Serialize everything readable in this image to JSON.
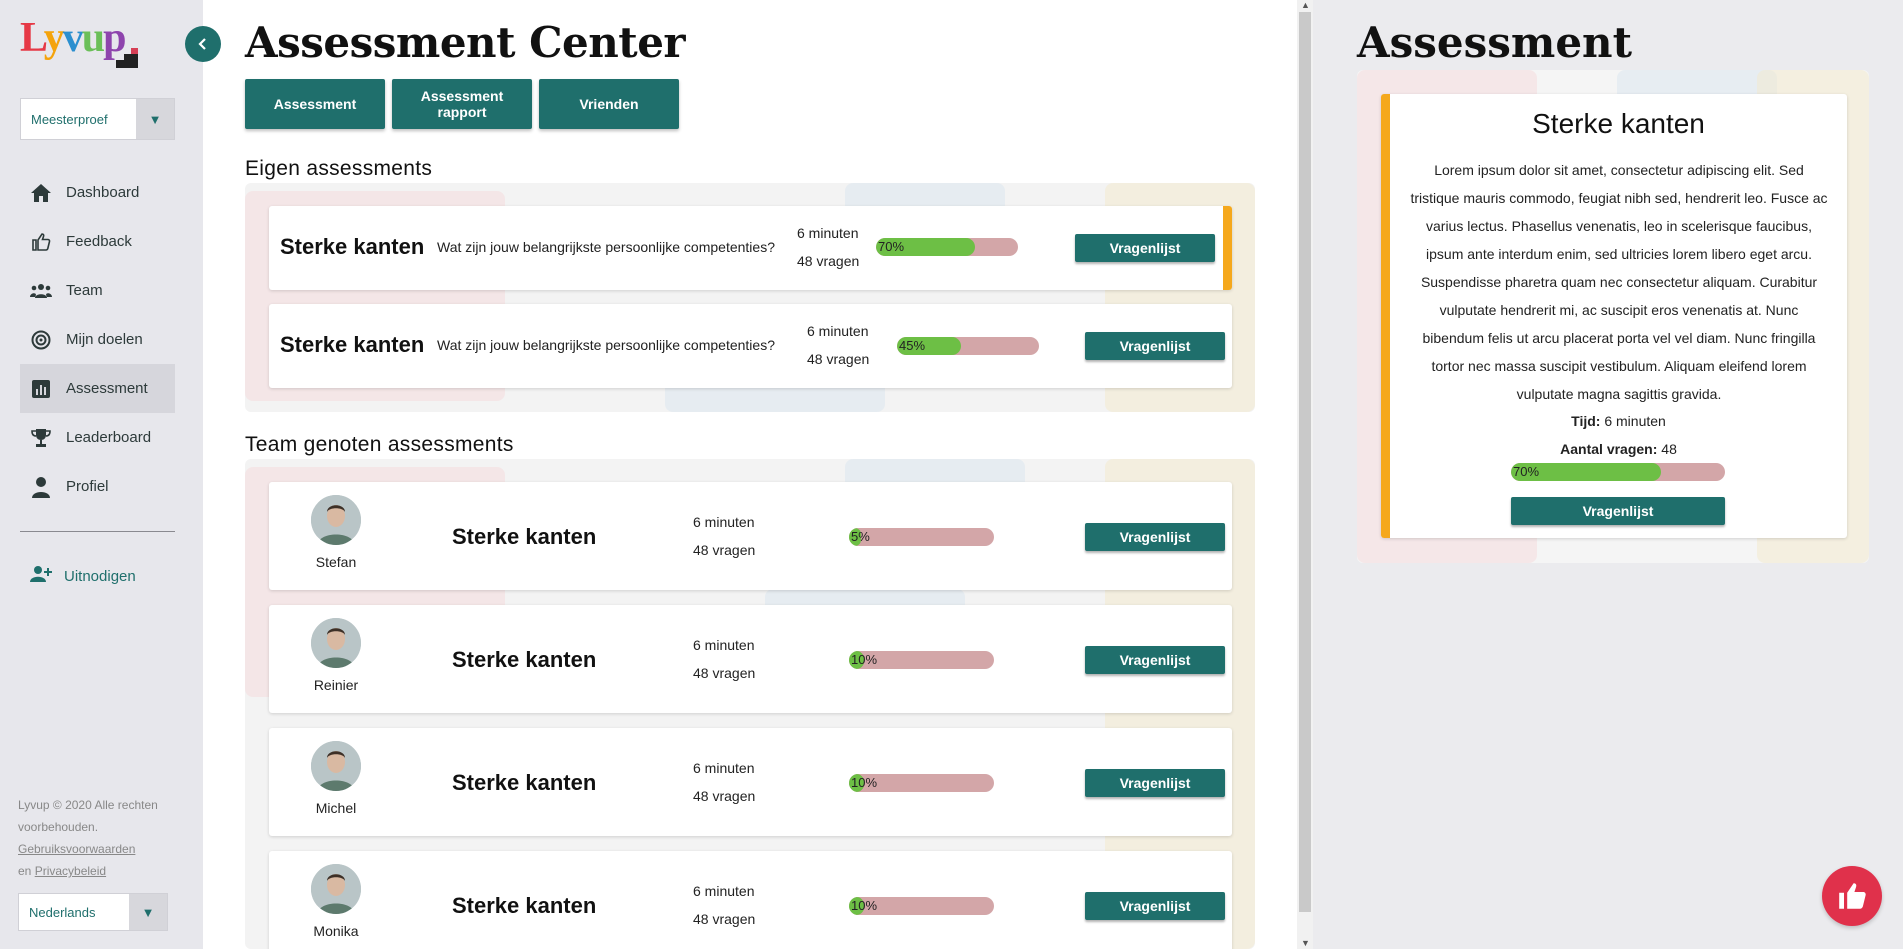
{
  "brand": {
    "logo_text": "Lyvup"
  },
  "sidebar": {
    "program_select": "Meesterproef",
    "items": [
      {
        "label": "Dashboard",
        "icon": "home-icon"
      },
      {
        "label": "Feedback",
        "icon": "thumbs-up-icon"
      },
      {
        "label": "Team",
        "icon": "team-icon"
      },
      {
        "label": "Mijn doelen",
        "icon": "target-icon"
      },
      {
        "label": "Assessment",
        "icon": "chart-icon",
        "active": true
      },
      {
        "label": "Leaderboard",
        "icon": "trophy-icon"
      },
      {
        "label": "Profiel",
        "icon": "user-icon"
      }
    ],
    "invite_label": "Uitnodigen",
    "footer": {
      "copyright": "Lyvup © 2020 Alle rechten voorbehouden.",
      "terms": "Gebruiksvoorwaarden",
      "and": "en",
      "privacy": "Privacybeleid"
    },
    "language": "Nederlands"
  },
  "main": {
    "title": "Assessment Center",
    "tabs": [
      {
        "label": "Assessment"
      },
      {
        "label": "Assessment rapport"
      },
      {
        "label": "Vrienden"
      }
    ],
    "own_section_title": "Eigen assessments",
    "own_assessments": [
      {
        "title": "Sterke kanten",
        "question": "Wat zijn jouw belangrijkste persoonlijke competenties?",
        "time": "6 minuten",
        "questions": "48 vragen",
        "progress": 70,
        "progress_label": "70%",
        "button": "Vragenlijst"
      },
      {
        "title": "Sterke kanten",
        "question": "Wat zijn jouw belangrijkste persoonlijke competenties?",
        "time": "6 minuten",
        "questions": "48 vragen",
        "progress": 45,
        "progress_label": "45%",
        "button": "Vragenlijst"
      }
    ],
    "team_section_title": "Team genoten assessments",
    "team_assessments": [
      {
        "name": "Stefan",
        "title": "Sterke kanten",
        "time": "6 minuten",
        "questions": "48 vragen",
        "progress": 5,
        "progress_label": "5%",
        "button": "Vragenlijst"
      },
      {
        "name": "Reinier",
        "title": "Sterke kanten",
        "time": "6 minuten",
        "questions": "48 vragen",
        "progress": 10,
        "progress_label": "10%",
        "button": "Vragenlijst"
      },
      {
        "name": "Michel",
        "title": "Sterke kanten",
        "time": "6 minuten",
        "questions": "48 vragen",
        "progress": 10,
        "progress_label": "10%",
        "button": "Vragenlijst"
      },
      {
        "name": "Monika",
        "title": "Sterke kanten",
        "time": "6 minuten",
        "questions": "48 vragen",
        "progress": 10,
        "progress_label": "10%",
        "button": "Vragenlijst"
      }
    ]
  },
  "detail": {
    "heading": "Assessment",
    "title": "Sterke kanten",
    "description": "Lorem ipsum dolor sit amet, consectetur adipiscing elit. Sed tristique mauris commodo, feugiat nibh sed, hendrerit leo. Fusce ac varius lectus. Phasellus venenatis, leo in scelerisque faucibus, ipsum ante interdum enim, sed ultricies lorem libero eget arcu. Suspendisse pharetra quam nec consectetur aliquam. Curabitur vulputate hendrerit mi, ac suscipit eros venenatis at. Nunc bibendum felis ut arcu placerat porta vel vel diam. Nunc fringilla tortor nec massa suscipit vestibulum. Aliquam eleifend lorem vulputate magna sagittis gravida.",
    "time_label": "Tijd:",
    "time_value": "6 minuten",
    "count_label": "Aantal vragen:",
    "count_value": "48",
    "progress": 70,
    "progress_label": "70%",
    "button": "Vragenlijst"
  },
  "colors": {
    "primary": "#1f6f6c",
    "accent": "#f5a81c",
    "progress_fill": "#6dbf45",
    "progress_track": "#d3a6a8",
    "fab": "#e0314b"
  }
}
